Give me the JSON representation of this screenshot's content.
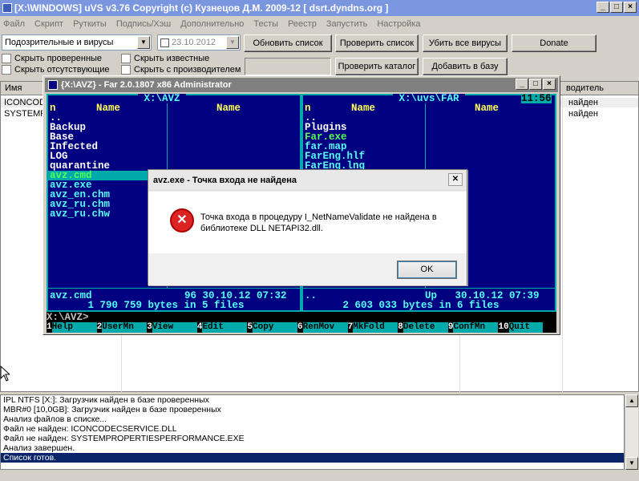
{
  "uvs": {
    "title": "[X:\\WINDOWS] uVS v3.76 Copyright (c) Кузнецов Д.М. 2009-12 [ dsrt.dyndns.org ]",
    "menu": [
      "Файл",
      "Скрипт",
      "Руткиты",
      "Подпись/Хэш",
      "Дополнительно",
      "Тесты",
      "Реестр",
      "Запустить",
      "Настройка"
    ],
    "filter_combo": "Подозрительные и вирусы",
    "date_combo": "23.10.2012",
    "buttons": {
      "refresh": "Обновить список",
      "check_list": "Проверить список",
      "kill_all": "Убить все вирусы",
      "donate": "Donate",
      "check_dir": "Проверить каталог",
      "add_db": "Добавить в базу"
    },
    "checks": {
      "hide_checked": "Скрыть проверенные",
      "hide_missing": "Скрыть отсутствующие",
      "hide_known": "Скрыть известные",
      "hide_vendor": "Скрыть с производителем"
    },
    "grid": {
      "col_name": "Имя",
      "col_vendor": "водитель",
      "rows": [
        {
          "name": "ICONCOD",
          "status": "найден"
        },
        {
          "name": "SYSTEMPR",
          "status": "найден"
        }
      ]
    },
    "log": [
      "IPL NTFS [X:]: Загрузчик найден в базе проверенных",
      "MBR#0 [10,0GB]: Загрузчик найден в базе проверенных",
      "Анализ файлов в списке...",
      "Файл не найден: ICONCODECSERVICE.DLL",
      "Файл не найден: SYSTEMPROPERTIESPERFORMANCE.EXE",
      "Анализ завершен.",
      "Список готов."
    ]
  },
  "far": {
    "title": "{X:\\AVZ} - Far 2.0.1807 x86 Administrator",
    "left_path": " X:\\AVZ ",
    "right_path": " X:\\uvs\\FAR ",
    "clock": "11:56",
    "col_n": "n",
    "col_name": "Name",
    "left_files": [
      "..",
      "Backup",
      "Base",
      "Infected",
      "LOG",
      "quarantine",
      "avz.cmd",
      "avz.exe",
      "avz_en.chm",
      "avz_ru.chm",
      "avz_ru.chw"
    ],
    "right_files": [
      "..",
      "Plugins",
      "Far.exe",
      "far.map",
      "FarEng.hlf",
      "FarEng.lng"
    ],
    "left_status_name": "avz.cmd",
    "left_status_info": "96 30.10.12 07:32",
    "right_status_name": "..",
    "right_status_info": "Up   30.10.12 07:39",
    "left_total": " 1 790 759 bytes in 5 files ",
    "right_total": " 2 603 033 bytes in 6 files ",
    "cmdline": "X:\\AVZ>",
    "keybar": [
      {
        "n": "1",
        "label": "Help"
      },
      {
        "n": "2",
        "label": "UserMn"
      },
      {
        "n": "3",
        "label": "View"
      },
      {
        "n": "4",
        "label": "Edit"
      },
      {
        "n": "5",
        "label": "Copy"
      },
      {
        "n": "6",
        "label": "RenMov"
      },
      {
        "n": "7",
        "label": "MkFold"
      },
      {
        "n": "8",
        "label": "Delete"
      },
      {
        "n": "9",
        "label": "ConfMn"
      },
      {
        "n": "10",
        "label": "Quit"
      }
    ]
  },
  "dialog": {
    "title": "avz.exe - Точка входа не найдена",
    "line1": "Точка входа в процедуру I_NetNameValidate не найдена в",
    "line2": "библиотеке DLL NETAPI32.dll.",
    "ok": "OK"
  }
}
